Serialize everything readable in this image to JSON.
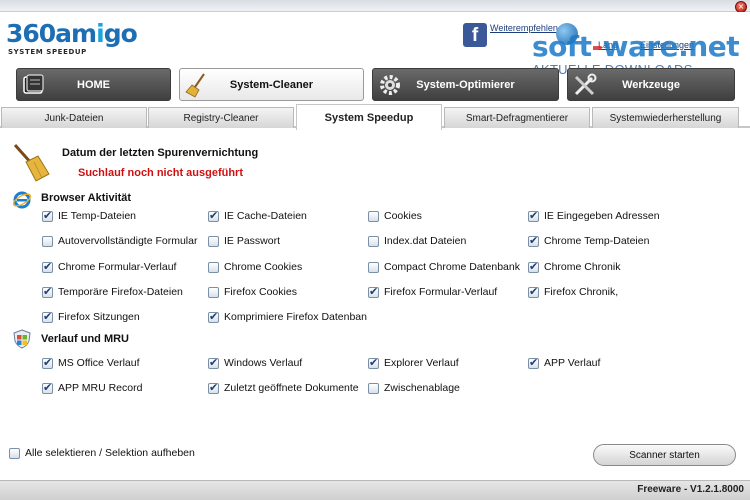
{
  "header": {
    "logo_text_a": "360am",
    "logo_text_b": "i",
    "logo_text_c": "go",
    "logo_subtitle": "SYSTEM SPEEDUP",
    "recommend_label": "Weiterempfehlen",
    "lang_label": "Lang",
    "settings_label": "Einstellungen",
    "watermark_a": "soft",
    "watermark_dash": "-",
    "watermark_b": "ware.net",
    "watermark_sub": "AKTUELLE DOWNLOADS",
    "close_glyph": "×"
  },
  "main_tabs": [
    {
      "label": "HOME",
      "icon": "book-icon",
      "active": false
    },
    {
      "label": "System-Cleaner",
      "icon": "broom-icon",
      "active": true
    },
    {
      "label": "System-Optimierer",
      "icon": "gear-icon",
      "active": false
    },
    {
      "label": "Werkzeuge",
      "icon": "tools-icon",
      "active": false
    }
  ],
  "sub_tabs": [
    {
      "label": "Junk-Dateien",
      "active": false
    },
    {
      "label": "Registry-Cleaner",
      "active": false
    },
    {
      "label": "System Speedup",
      "active": true
    },
    {
      "label": "Smart-Defragmentierer",
      "active": false
    },
    {
      "label": "Systemwiederherstellung",
      "active": false
    }
  ],
  "last_run": {
    "label": "Datum der letzten Spurenvernichtung",
    "status": "Suchlauf noch nicht ausgeführt",
    "status_color": "#d01010"
  },
  "browser_section": {
    "title": "Browser Aktivität",
    "icon": "ie-icon",
    "options": [
      {
        "label": "IE Temp-Dateien",
        "checked": true
      },
      {
        "label": "IE Cache-Dateien",
        "checked": true
      },
      {
        "label": "Cookies",
        "checked": false
      },
      {
        "label": "IE Eingegeben Adressen",
        "checked": true
      },
      {
        "label": "Autovervollständigte Formular",
        "checked": false
      },
      {
        "label": "IE Passwort",
        "checked": false
      },
      {
        "label": "Index.dat Dateien",
        "checked": false
      },
      {
        "label": "Chrome Temp-Dateien",
        "checked": true
      },
      {
        "label": "Chrome Formular-Verlauf",
        "checked": true
      },
      {
        "label": "Chrome Cookies",
        "checked": false
      },
      {
        "label": "Compact Chrome Datenbank",
        "checked": false
      },
      {
        "label": "Chrome Chronik",
        "checked": true
      },
      {
        "label": "Temporäre Firefox-Dateien",
        "checked": true
      },
      {
        "label": "Firefox Cookies",
        "checked": false
      },
      {
        "label": "Firefox Formular-Verlauf",
        "checked": true
      },
      {
        "label": "Firefox Chronik,",
        "checked": true
      },
      {
        "label": "Firefox Sitzungen",
        "checked": true
      },
      {
        "label": "Komprimiere Firefox Datenban",
        "checked": true
      }
    ]
  },
  "mru_section": {
    "title": "Verlauf und MRU",
    "icon": "windows-shield-icon",
    "options": [
      {
        "label": "MS Office Verlauf",
        "checked": true
      },
      {
        "label": "Windows Verlauf",
        "checked": true
      },
      {
        "label": "Explorer Verlauf",
        "checked": true
      },
      {
        "label": "APP Verlauf",
        "checked": true
      },
      {
        "label": "APP MRU Record",
        "checked": true
      },
      {
        "label": "Zuletzt geöffnete Dokumente",
        "checked": true
      },
      {
        "label": "Zwischenablage",
        "checked": false
      }
    ]
  },
  "select_all": {
    "label": "Alle selektieren / Selektion aufheben",
    "checked": false
  },
  "scan_button": {
    "label": "Scanner starten"
  },
  "footer": {
    "version": "Freeware - V1.2.1.8000"
  },
  "colors": {
    "accent": "#1aa6dd",
    "tab_dark": "#4a4a4a"
  }
}
